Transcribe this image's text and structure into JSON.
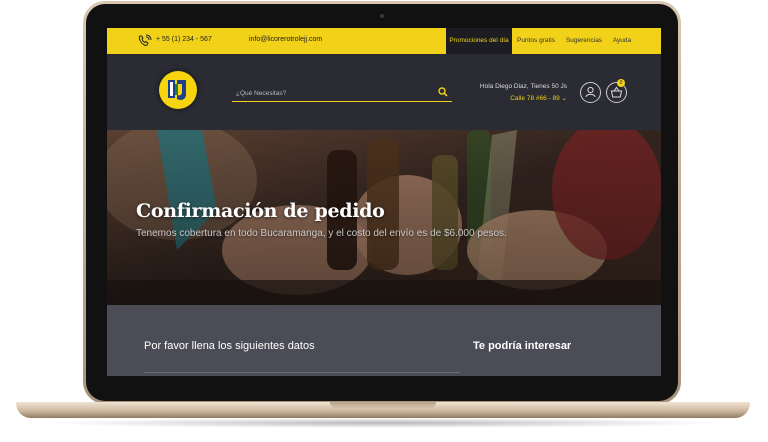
{
  "topbar": {
    "phone": "+ 55 (1) 234 - 567",
    "email": "info@licorerotrolejj.com",
    "nav": [
      "Promociones del día",
      "Puntos gratis",
      "Sugerencias",
      "Ayuda"
    ]
  },
  "header": {
    "search_placeholder": "¿Qué Necesitas?",
    "greeting": "Hola Diego Diaz, Tienes 50 Js",
    "address": "Calle 78 #66 - 89",
    "cart_count": "0"
  },
  "hero": {
    "title": "Confirmación de pedido",
    "subtitle": "Tenemos cobertura en todo Bucaramanga, y el costo del envío es de $6.000 pesos."
  },
  "content": {
    "form_heading": "Por favor llena los siguientes datos",
    "aside_heading": "Te podría interesar"
  },
  "colors": {
    "accent": "#f2d218",
    "header_bg": "#2a2b33",
    "content_bg": "#4b4c56"
  }
}
